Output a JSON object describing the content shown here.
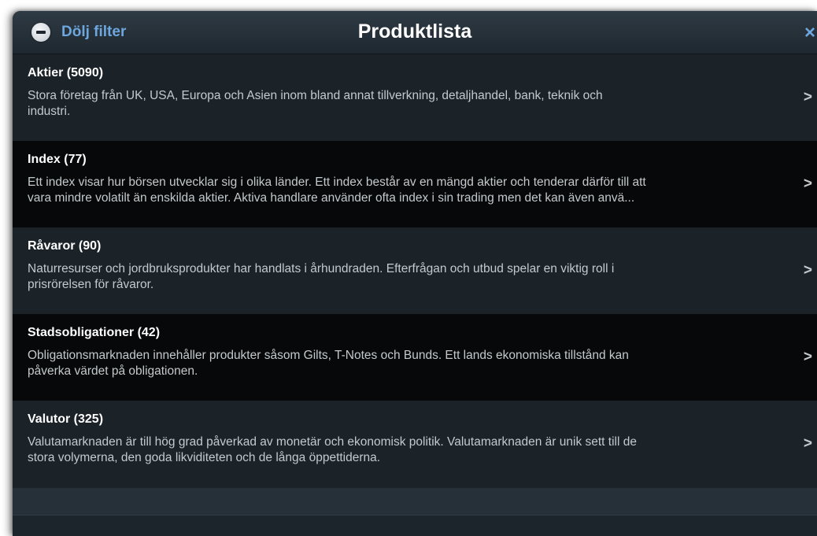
{
  "header": {
    "filter_label": "Dölj filter",
    "title": "Produktlista",
    "close_glyph": "×",
    "filter_icon": "minus-circle-icon",
    "close_icon": "close-icon"
  },
  "items": [
    {
      "title": "Aktier (5090)",
      "description": "Stora företag från UK, USA, Europa och Asien inom bland annat tillverkning, detaljhandel, bank, teknik och\nindustri.",
      "chevron": ">"
    },
    {
      "title": "Index (77)",
      "description": "Ett index visar hur börsen utvecklar sig i olika länder. Ett index består av en mängd aktier och tenderar därför till att\nvara mindre volatilt än enskilda aktier. Aktiva handlare använder ofta index i sin trading men det kan även anvä...",
      "chevron": ">"
    },
    {
      "title": "Råvaror (90)",
      "description": "Naturresurser och jordbruksprodukter har handlats i århundraden. Efterfrågan och utbud spelar en viktig roll i\nprisrörelsen för råvaror.",
      "chevron": ">"
    },
    {
      "title": "Stadsobligationer (42)",
      "description": "Obligationsmarknaden innehåller produkter såsom Gilts, T-Notes och Bunds. Ett lands ekonomiska tillstånd kan\npåverka värdet på obligationen.",
      "chevron": ">"
    },
    {
      "title": "Valutor (325)",
      "description": "Valutamarknaden är till hög grad påverkad av monetär och ekonomisk politik. Valutamarknaden är unik sett till de\nstora volymerna, den goda likviditeten och de långa öppettiderna.",
      "chevron": ">"
    }
  ],
  "colors": {
    "accent": "#6ea6de",
    "panel": "#1c242b",
    "row_dark": "#060809",
    "row_light": "#1b2329"
  }
}
